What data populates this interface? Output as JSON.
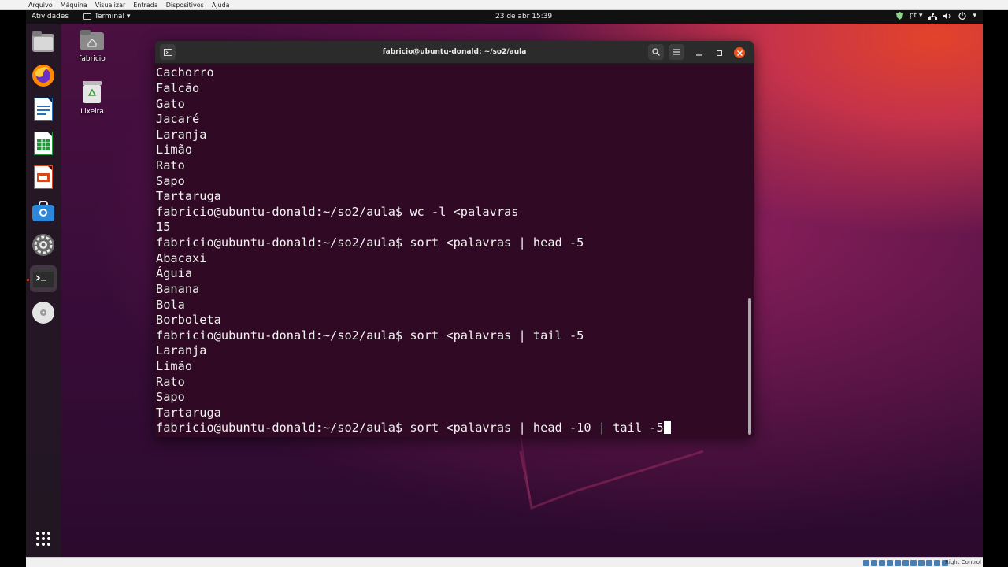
{
  "vbox_menu": [
    "Arquivo",
    "Máquina",
    "Visualizar",
    "Entrada",
    "Dispositivos",
    "Ajuda"
  ],
  "top_panel": {
    "activities": "Atividades",
    "app_menu": "Terminal ▾",
    "clock": "23 de abr  15:39",
    "language": "pt ▾"
  },
  "desktop_icons": {
    "home": "fabricio",
    "trash": "Lixeira"
  },
  "dock": [
    "files-icon",
    "firefox-icon",
    "writer-icon",
    "calc-icon",
    "impress-icon",
    "software-icon",
    "settings-icon",
    "terminal-icon",
    "dvd-icon",
    "show-apps-icon"
  ],
  "terminal": {
    "title": "fabricio@ubuntu-donald: ~/so2/aula",
    "lines": [
      "Cachorro",
      "Falcão",
      "Gato",
      "Jacaré",
      "Laranja",
      "Limão",
      "Rato",
      "Sapo",
      "Tartaruga",
      "fabricio@ubuntu-donald:~/so2/aula$ wc -l <palavras",
      "15",
      "fabricio@ubuntu-donald:~/so2/aula$ sort <palavras | head -5",
      "Abacaxi",
      "Águia",
      "Banana",
      "Bola",
      "Borboleta",
      "fabricio@ubuntu-donald:~/so2/aula$ sort <palavras | tail -5",
      "Laranja",
      "Limão",
      "Rato",
      "Sapo",
      "Tartaruga",
      "fabricio@ubuntu-donald:~/so2/aula$ sort <palavras | head -10 | tail -5"
    ]
  },
  "statusbar": {
    "host_key": "Right Control"
  },
  "colors": {
    "terminal_bg": "#300a24",
    "accent": "#e95420",
    "panel": "#111111"
  }
}
